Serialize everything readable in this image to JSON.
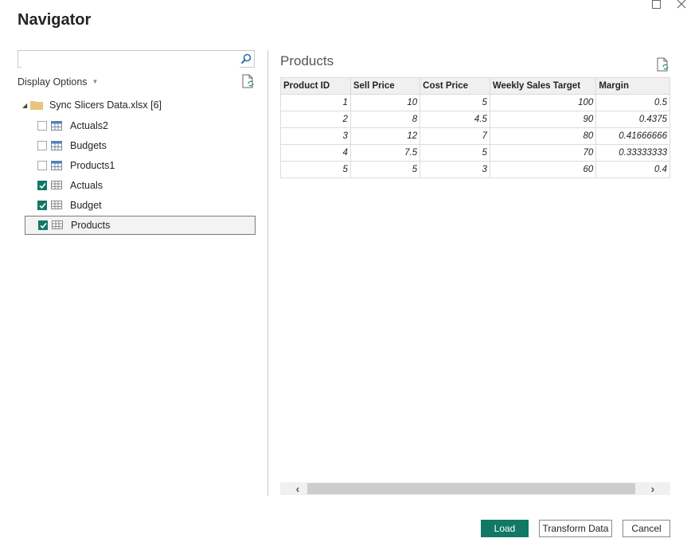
{
  "window": {
    "title": "Navigator",
    "maximize_icon": "maximize-icon",
    "close_icon": "close-icon"
  },
  "left_pane": {
    "search": {
      "value": "",
      "placeholder": "",
      "icon": "search-icon"
    },
    "display_options_label": "Display Options",
    "refresh_icon": "refresh-document-icon",
    "tree": {
      "root": {
        "label": "Sync Slicers Data.xlsx [6]",
        "icon": "folder-icon",
        "expanded": true
      },
      "items": [
        {
          "label": "Actuals2",
          "checked": false,
          "icon": "table-icon",
          "selected": false
        },
        {
          "label": "Budgets",
          "checked": false,
          "icon": "table-icon",
          "selected": false
        },
        {
          "label": "Products1",
          "checked": false,
          "icon": "table-icon",
          "selected": false
        },
        {
          "label": "Actuals",
          "checked": true,
          "icon": "sheet-icon",
          "selected": false
        },
        {
          "label": "Budget",
          "checked": true,
          "icon": "sheet-icon",
          "selected": false
        },
        {
          "label": "Products",
          "checked": true,
          "icon": "sheet-icon",
          "selected": true
        }
      ]
    }
  },
  "preview": {
    "title": "Products",
    "refresh_icon": "refresh-document-icon",
    "columns": [
      "Product ID",
      "Sell Price",
      "Cost Price",
      "Weekly Sales Target",
      "Margin"
    ],
    "rows": [
      [
        "1",
        "10",
        "5",
        "100",
        "0.5"
      ],
      [
        "2",
        "8",
        "4.5",
        "90",
        "0.4375"
      ],
      [
        "3",
        "12",
        "7",
        "80",
        "0.41666666"
      ],
      [
        "4",
        "7.5",
        "5",
        "70",
        "0.33333333"
      ],
      [
        "5",
        "5",
        "3",
        "60",
        "0.4"
      ]
    ],
    "scrollbar": {
      "left_arrow": "‹",
      "right_arrow": "›"
    }
  },
  "footer": {
    "load_label": "Load",
    "transform_label": "Transform Data",
    "cancel_label": "Cancel"
  },
  "colors": {
    "accent": "#117865",
    "border": "#c8c8c8",
    "header_bg": "#f0f0f0"
  }
}
